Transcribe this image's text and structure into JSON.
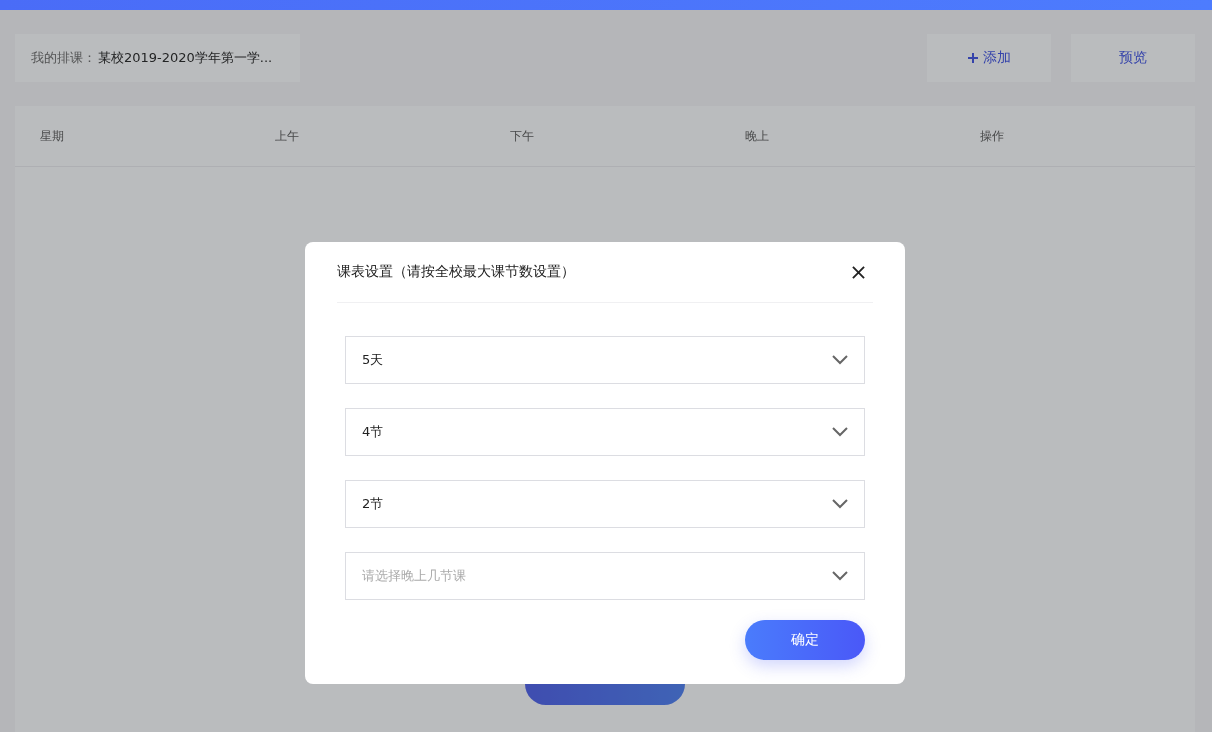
{
  "header": {
    "label": "我的排课：",
    "value": "某校2019-2020学年第一学..."
  },
  "actions": [
    {
      "kind": "add",
      "label": "添加"
    },
    {
      "kind": "plain",
      "label": "预览"
    }
  ],
  "table": {
    "columns": [
      "星期",
      "上午",
      "下午",
      "晚上",
      "操作"
    ]
  },
  "dialog": {
    "title": "课表设置（请按全校最大课节数设置）",
    "selects": [
      {
        "value": "5天"
      },
      {
        "value": "4节"
      },
      {
        "value": "2节"
      },
      {
        "placeholder": "请选择晚上几节课"
      }
    ],
    "confirm": "确定"
  }
}
